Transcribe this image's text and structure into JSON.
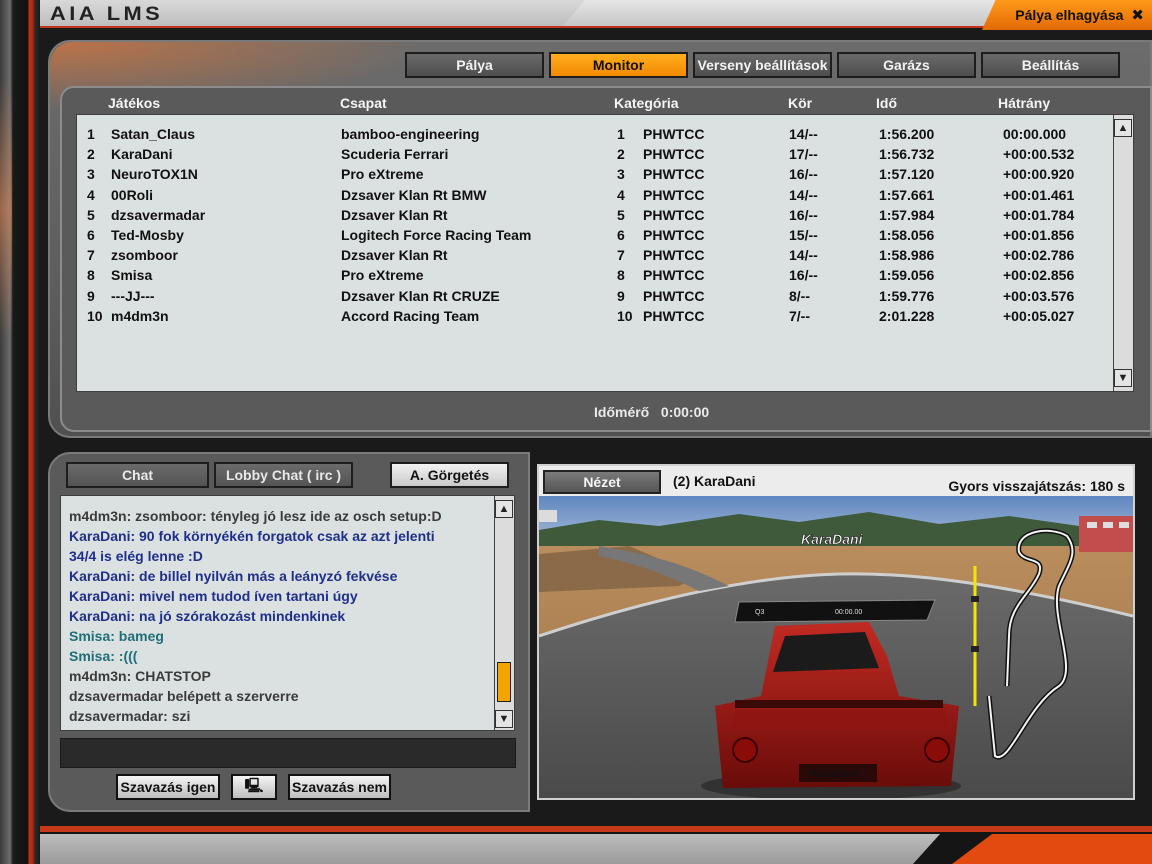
{
  "app": {
    "logo": "AIA LMS",
    "leave_label": "Pálya elhagyása"
  },
  "tabs": [
    {
      "label": "Pálya",
      "active": false
    },
    {
      "label": "Monitor",
      "active": true
    },
    {
      "label": "Verseny beállítások",
      "active": false
    },
    {
      "label": "Garázs",
      "active": false
    },
    {
      "label": "Beállítás",
      "active": false
    }
  ],
  "table": {
    "headers": {
      "player": "Játékos",
      "team": "Csapat",
      "category": "Kategória",
      "lap": "Kör",
      "time": "Idő",
      "gap": "Hátrány"
    },
    "rows": [
      {
        "pos": "1",
        "player": "Satan_Claus",
        "team": "bamboo-engineering",
        "cpos": "1",
        "cat": "PHWTCC",
        "lap": "14/--",
        "time": "1:56.200",
        "gap": "00:00.000"
      },
      {
        "pos": "2",
        "player": "KaraDani",
        "team": "Scuderia Ferrari",
        "cpos": "2",
        "cat": "PHWTCC",
        "lap": "17/--",
        "time": "1:56.732",
        "gap": "+00:00.532"
      },
      {
        "pos": "3",
        "player": "NeuroTOX1N",
        "team": "Pro eXtreme",
        "cpos": "3",
        "cat": "PHWTCC",
        "lap": "16/--",
        "time": "1:57.120",
        "gap": "+00:00.920"
      },
      {
        "pos": "4",
        "player": "00Roli",
        "team": "Dzsaver Klan Rt BMW",
        "cpos": "4",
        "cat": "PHWTCC",
        "lap": "14/--",
        "time": "1:57.661",
        "gap": "+00:01.461"
      },
      {
        "pos": "5",
        "player": "dzsavermadar",
        "team": "Dzsaver Klan Rt",
        "cpos": "5",
        "cat": "PHWTCC",
        "lap": "16/--",
        "time": "1:57.984",
        "gap": "+00:01.784"
      },
      {
        "pos": "6",
        "player": "Ted-Mosby",
        "team": "Logitech Force Racing Team",
        "cpos": "6",
        "cat": "PHWTCC",
        "lap": "15/--",
        "time": "1:58.056",
        "gap": "+00:01.856"
      },
      {
        "pos": "7",
        "player": "zsomboor",
        "team": "Dzsaver Klan Rt",
        "cpos": "7",
        "cat": "PHWTCC",
        "lap": "14/--",
        "time": "1:58.986",
        "gap": "+00:02.786"
      },
      {
        "pos": "8",
        "player": "Smisa",
        "team": "Pro eXtreme",
        "cpos": "8",
        "cat": "PHWTCC",
        "lap": "16/--",
        "time": "1:59.056",
        "gap": "+00:02.856"
      },
      {
        "pos": "9",
        "player": "---JJ---",
        "team": "Dzsaver Klan Rt CRUZE",
        "cpos": "9",
        "cat": "PHWTCC",
        "lap": "8/--",
        "time": "1:59.776",
        "gap": "+00:03.576"
      },
      {
        "pos": "10",
        "player": "m4dm3n",
        "team": "Accord Racing Team",
        "cpos": "10",
        "cat": "PHWTCC",
        "lap": "7/--",
        "time": "2:01.228",
        "gap": "+00:05.027"
      }
    ],
    "timer_label": "Időmérő",
    "timer_value": "0:00:00"
  },
  "chat": {
    "tabs": [
      "Chat",
      "Lobby Chat ( irc )",
      "A. Görgetés"
    ],
    "lines": [
      {
        "text": "m4dm3n: zsomboor: tényleg jó lesz ide az osch setup:D",
        "color": "#3b3b3b"
      },
      {
        "text": "KaraDani: 90 fok környékén forgatok csak az azt jelenti",
        "color": "#1f2f8a"
      },
      {
        "text": "34/4 is elég lenne :D",
        "color": "#1f2f8a"
      },
      {
        "text": "KaraDani: de billel nyilván más a leányzó fekvése",
        "color": "#1f2f8a"
      },
      {
        "text": "KaraDani: mivel nem tudod íven tartani úgy",
        "color": "#1f2f8a"
      },
      {
        "text": "KaraDani: na jó szórakozást mindenkinek",
        "color": "#1f2f8a"
      },
      {
        "text": "Smisa: bameg",
        "color": "#1f6f78"
      },
      {
        "text": "Smisa: :(((",
        "color": "#1f6f78"
      },
      {
        "text": "m4dm3n: CHATSTOP",
        "color": "#3b3b3b"
      },
      {
        "text": "dzsavermadar belépett a szerverre",
        "color": "#3b3b3b"
      },
      {
        "text": "dzsavermadar: szi",
        "color": "#3b3b3b"
      }
    ],
    "vote_yes": "Szavazás igen",
    "vote_no": "Szavazás nem"
  },
  "view": {
    "button": "Nézet",
    "player": "(2) KaraDani",
    "replay": "Gyors visszajátszás: 180 s",
    "car_label": "KaraDani",
    "hud_left": "Q3",
    "hud_time": "00:00.00"
  },
  "colors": {
    "accent": "#f28a00",
    "brand_red": "#c23218"
  }
}
